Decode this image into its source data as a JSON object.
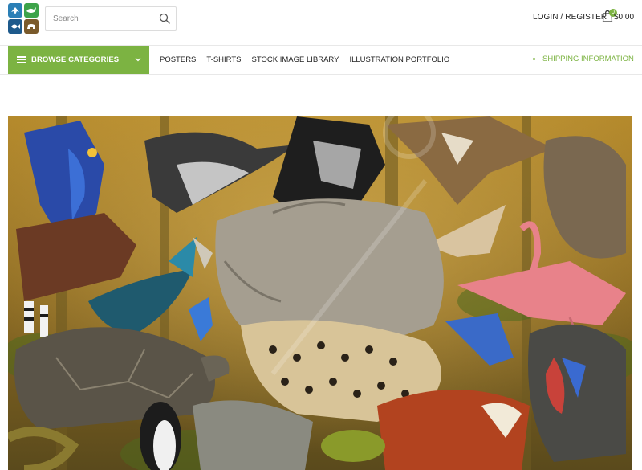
{
  "header": {
    "logo": {
      "icons": [
        "bird-icon",
        "whale-icon",
        "fish-icon",
        "rhino-icon"
      ]
    },
    "search": {
      "placeholder": "Search",
      "value": "",
      "icon": "search-icon"
    },
    "login_label": "LOGIN / REGISTER",
    "cart": {
      "icon": "shopping-bag-icon",
      "count": "0",
      "total": "$0.00"
    }
  },
  "nav": {
    "browse_label": "BROWSE CATEGORIES",
    "links": [
      "POSTERS",
      "T-SHIRTS",
      "STOCK IMAGE LIBRARY",
      "ILLUSTRATION PORTFOLIO"
    ],
    "shipping_label": "SHIPPING INFORMATION"
  },
  "hero": {
    "description_icon": "wildlife-collage-illustration"
  },
  "colors": {
    "accent": "#7cb342",
    "text": "#222222",
    "border": "#dcdcdc"
  }
}
